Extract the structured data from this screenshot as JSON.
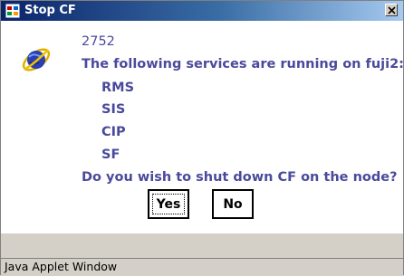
{
  "window": {
    "title": "Stop CF",
    "close_label": "×"
  },
  "message": {
    "code": "2752",
    "intro": "The following services are running on fuji2:",
    "services": [
      "RMS",
      "SIS",
      "CIP",
      "SF"
    ],
    "question": "Do you wish to shut down CF on the node?",
    "text_color": "#4a4a9c"
  },
  "buttons": {
    "yes": "Yes",
    "no": "No"
  },
  "statusbar": {
    "text": "Java Applet Window"
  },
  "icons": {
    "app": "java-cup-icon",
    "message": "globe-satellite-icon",
    "close": "close-icon"
  }
}
